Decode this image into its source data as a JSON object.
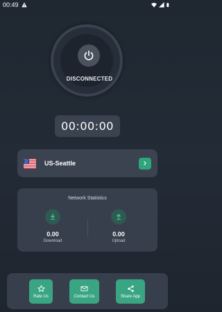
{
  "status_bar": {
    "time": "00:49",
    "warning_icon": "warning-icon",
    "wifi_icon": "wifi-icon",
    "signal_icon": "signal-icon",
    "battery_icon": "battery-icon"
  },
  "connection": {
    "status": "DISCONNECTED",
    "power_icon": "power-icon"
  },
  "timer": {
    "value": "00:00:00"
  },
  "server": {
    "flag_icon": "us-flag-icon",
    "name": "US-Seattle",
    "arrow_icon": "chevron-right-icon"
  },
  "network_stats": {
    "title": "Network Statistics",
    "download": {
      "value": "0.00",
      "label": "Download",
      "icon": "download-icon"
    },
    "upload": {
      "value": "0.00",
      "label": "Upload",
      "icon": "upload-icon"
    }
  },
  "actions": [
    {
      "label": "Rate Us",
      "icon": "star-icon"
    },
    {
      "label": "Contact Us",
      "icon": "mail-icon"
    },
    {
      "label": "Share App",
      "icon": "share-icon"
    }
  ],
  "colors": {
    "background": "#1f2731",
    "card": "#3a434f",
    "accent": "#3aa583"
  }
}
